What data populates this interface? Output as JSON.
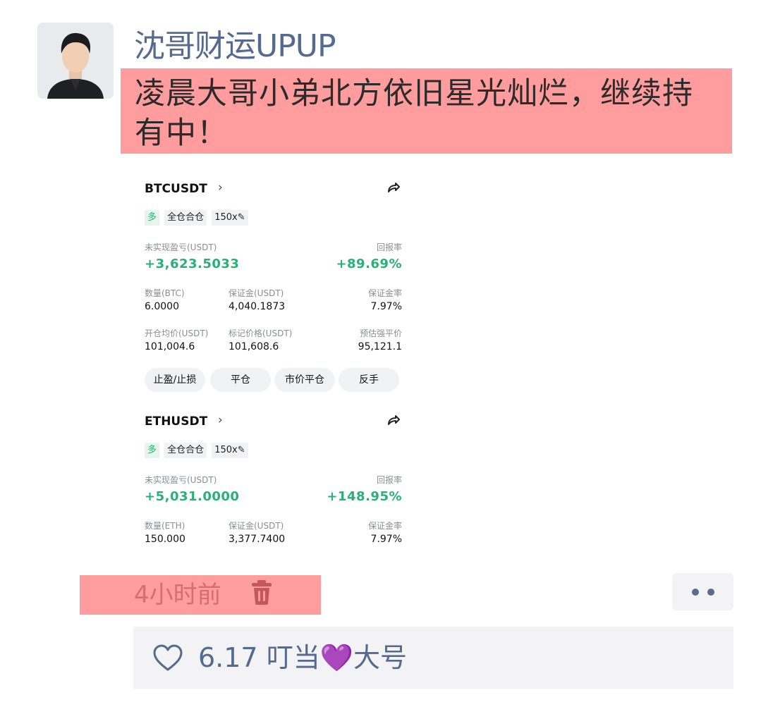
{
  "post": {
    "username": "沈哥财运UPUP",
    "text": "凌晨大哥小弟北方依旧星光灿烂，继续持有中！",
    "time": "4小时前",
    "likes_text": "6.17  叮当💜大号"
  },
  "positions": [
    {
      "symbol": "BTCUSDT",
      "tags": [
        "多",
        "全仓合仓",
        "150x"
      ],
      "unrealized_label": "未实现盈亏(USDT)",
      "unrealized_value": "+3,623.5033",
      "roe_label": "回报率",
      "roe_value": "+89.69%",
      "qty_label": "数量(BTC)",
      "qty_value": "6.0000",
      "margin_label": "保证金(USDT)",
      "margin_value": "4,040.1873",
      "margin_ratio_label": "保证金率",
      "margin_ratio_value": "7.97%",
      "entry_label": "开仓均价(USDT)",
      "entry_value": "101,004.6",
      "mark_label": "标记价格(USDT)",
      "mark_value": "101,608.6",
      "liq_label": "预估强平价",
      "liq_value": "95,121.1",
      "buttons": [
        "止盈/止损",
        "平仓",
        "市价平仓",
        "反手"
      ]
    },
    {
      "symbol": "ETHUSDT",
      "tags": [
        "多",
        "全仓合仓",
        "150x"
      ],
      "unrealized_label": "未实现盈亏(USDT)",
      "unrealized_value": "+5,031.0000",
      "roe_label": "回报率",
      "roe_value": "+148.95%",
      "qty_label": "数量(ETH)",
      "qty_value": "150.000",
      "margin_label": "保证金(USDT)",
      "margin_value": "3,377.7400",
      "margin_ratio_label": "保证金率",
      "margin_ratio_value": "7.97%"
    }
  ],
  "colors": {
    "username": "#56698f",
    "highlight": "#ff9c9d",
    "profit_green": "#28b079"
  },
  "icons": {
    "share": "share-icon",
    "trash": "trash-icon",
    "heart": "heart-outline-icon",
    "more": "more-icon"
  }
}
